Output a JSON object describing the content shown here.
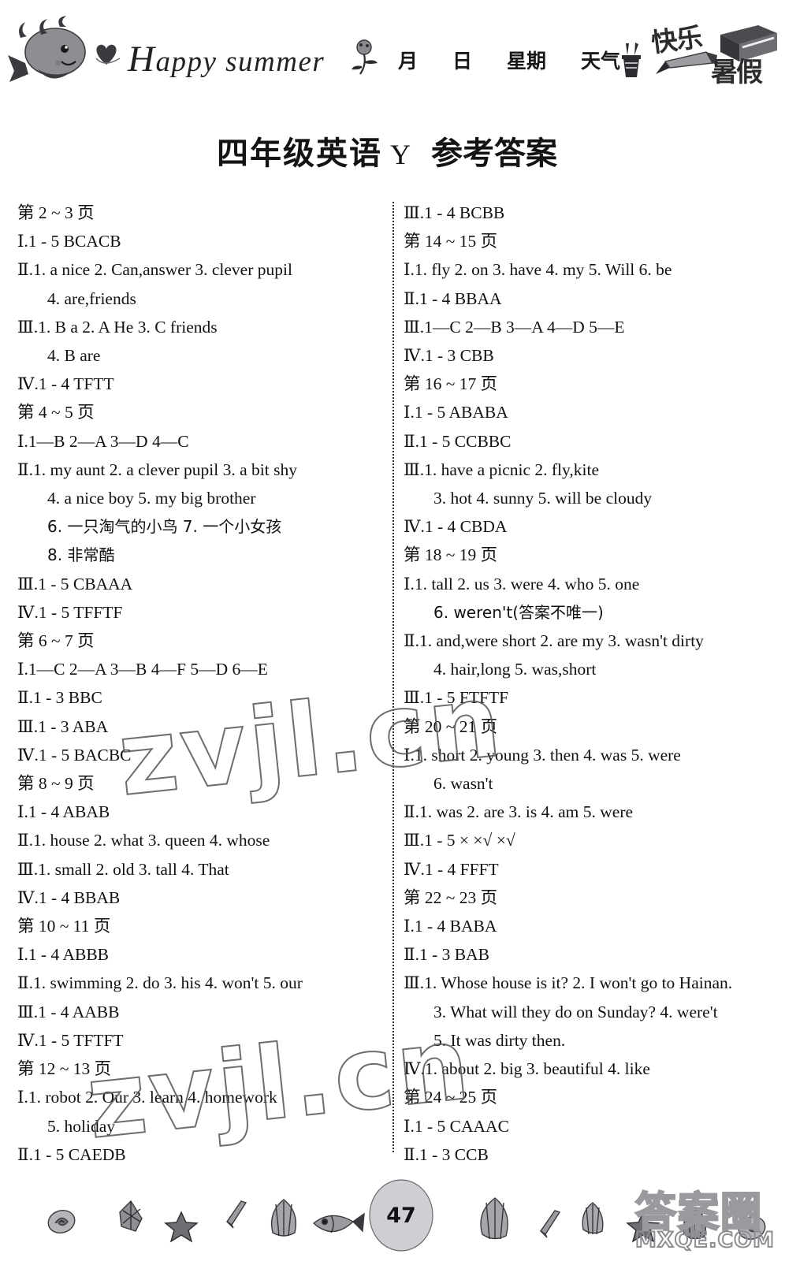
{
  "header": {
    "happy_summer_cap": "H",
    "happy_summer_rest": "appy summer",
    "date_fields": [
      "月",
      "日",
      "星期",
      "天气"
    ],
    "holiday_line1": "快乐",
    "holiday_line2": "暑假",
    "icons": {
      "whale": "whale-icon",
      "heart": "heart-icon",
      "flower": "flower-icon",
      "pencil_pot": "pencil-pot-icon",
      "book": "book-icon",
      "pencil": "pencil-icon"
    }
  },
  "title": {
    "subject": "四年级英语",
    "version": "Y",
    "label": "参考答案"
  },
  "left_column": [
    {
      "type": "page_head",
      "text": "第 2 ~ 3 页"
    },
    {
      "type": "answer",
      "text": "Ⅰ.1 - 5   BCACB"
    },
    {
      "type": "answer",
      "text": "Ⅱ.1. a nice   2. Can,answer   3. clever pupil"
    },
    {
      "type": "cont",
      "text": "4. are,friends"
    },
    {
      "type": "answer",
      "text": "Ⅲ.1. B   a   2. A   He   3. C   friends"
    },
    {
      "type": "cont",
      "text": "4. B   are"
    },
    {
      "type": "answer",
      "text": "Ⅳ.1 - 4   TFTT"
    },
    {
      "type": "page_head",
      "text": "第 4 ~ 5 页"
    },
    {
      "type": "answer",
      "text": "Ⅰ.1—B   2—A   3—D   4—C"
    },
    {
      "type": "answer",
      "text": "Ⅱ.1. my aunt   2. a clever pupil   3. a bit shy"
    },
    {
      "type": "cont",
      "text": "4. a nice boy   5. my big brother"
    },
    {
      "type": "cont_cn",
      "text": "6. 一只淘气的小鸟   7. 一个小女孩"
    },
    {
      "type": "cont_cn",
      "text": "8. 非常酷"
    },
    {
      "type": "answer",
      "text": "Ⅲ.1 - 5   CBAAA"
    },
    {
      "type": "answer",
      "text": "Ⅳ.1 - 5   TFFTF"
    },
    {
      "type": "page_head",
      "text": "第 6 ~ 7 页"
    },
    {
      "type": "answer",
      "text": "Ⅰ.1—C  2—A   3—B   4—F   5—D   6—E"
    },
    {
      "type": "answer",
      "text": "Ⅱ.1 - 3   BBC"
    },
    {
      "type": "answer",
      "text": "Ⅲ.1 - 3   ABA"
    },
    {
      "type": "answer",
      "text": "Ⅳ.1 - 5   BACBC"
    },
    {
      "type": "page_head",
      "text": "第 8 ~ 9 页"
    },
    {
      "type": "answer",
      "text": "Ⅰ.1 - 4   ABAB"
    },
    {
      "type": "answer",
      "text": "Ⅱ.1. house   2. what   3. queen   4. whose"
    },
    {
      "type": "answer",
      "text": "Ⅲ.1. small   2. old   3. tall   4. That"
    },
    {
      "type": "answer",
      "text": "Ⅳ.1 - 4   BBAB"
    },
    {
      "type": "page_head",
      "text": "第 10 ~ 11 页"
    },
    {
      "type": "answer",
      "text": "Ⅰ.1 - 4   ABBB"
    },
    {
      "type": "answer",
      "text": "Ⅱ.1. swimming   2. do   3. his   4. won't   5. our"
    },
    {
      "type": "answer",
      "text": "Ⅲ.1 - 4   AABB"
    },
    {
      "type": "answer",
      "text": "Ⅳ.1 - 5   TFTFT"
    },
    {
      "type": "page_head",
      "text": "第 12 ~ 13 页"
    },
    {
      "type": "answer",
      "text": "Ⅰ.1. robot   2. Our   3. learn   4. homework"
    },
    {
      "type": "cont",
      "text": "5. holiday"
    },
    {
      "type": "answer",
      "text": "Ⅱ.1 - 5   CAEDB"
    }
  ],
  "right_column": [
    {
      "type": "answer",
      "text": "Ⅲ.1 - 4   BCBB"
    },
    {
      "type": "page_head",
      "text": "第 14 ~ 15 页"
    },
    {
      "type": "answer",
      "text": "Ⅰ.1. fly   2. on   3. have   4. my   5. Will   6. be"
    },
    {
      "type": "answer",
      "text": "Ⅱ.1 - 4   BBAA"
    },
    {
      "type": "answer",
      "text": "Ⅲ.1—C   2—B   3—A   4—D   5—E"
    },
    {
      "type": "answer",
      "text": "Ⅳ.1 - 3   CBB"
    },
    {
      "type": "page_head",
      "text": "第 16 ~ 17 页"
    },
    {
      "type": "answer",
      "text": "Ⅰ.1 - 5   ABABA"
    },
    {
      "type": "answer",
      "text": "Ⅱ.1 - 5   CCBBC"
    },
    {
      "type": "answer",
      "text": "Ⅲ.1. have a picnic   2. fly,kite"
    },
    {
      "type": "cont",
      "text": "3. hot   4. sunny   5. will be cloudy"
    },
    {
      "type": "answer",
      "text": "Ⅳ.1 - 4   CBDA"
    },
    {
      "type": "page_head",
      "text": "第 18 ~ 19 页"
    },
    {
      "type": "answer",
      "text": "Ⅰ.1. tall   2. us   3. were   4. who   5. one"
    },
    {
      "type": "cont_cn",
      "text": "6. weren't(答案不唯一)"
    },
    {
      "type": "answer",
      "text": "Ⅱ.1. and,were short   2. are my   3. wasn't dirty"
    },
    {
      "type": "cont",
      "text": "4. hair,long   5. was,short"
    },
    {
      "type": "answer",
      "text": "Ⅲ.1 - 5   FTFTF"
    },
    {
      "type": "page_head",
      "text": "第 20 ~ 21 页"
    },
    {
      "type": "answer",
      "text": "Ⅰ.1. short   2. young   3. then   4. was   5. were"
    },
    {
      "type": "cont",
      "text": "6. wasn't"
    },
    {
      "type": "answer",
      "text": "Ⅱ.1. was   2. are   3. is   4. am   5. were"
    },
    {
      "type": "answer",
      "text": "Ⅲ.1 - 5   × ×√ ×√"
    },
    {
      "type": "answer",
      "text": "Ⅳ.1 - 4   FFFT"
    },
    {
      "type": "page_head",
      "text": "第 22 ~ 23 页"
    },
    {
      "type": "answer",
      "text": "Ⅰ.1 - 4   BABA"
    },
    {
      "type": "answer",
      "text": "Ⅱ.1 - 3   BAB"
    },
    {
      "type": "answer",
      "text": "Ⅲ.1. Whose house is it?   2. I won't go to Hainan."
    },
    {
      "type": "cont",
      "text": "3. What will they do on Sunday?    4. were't"
    },
    {
      "type": "cont",
      "text": "5. It was dirty then."
    },
    {
      "type": "answer",
      "text": "Ⅳ.1. about   2. big   3. beautiful   4. like"
    },
    {
      "type": "page_head",
      "text": "第 24 ~ 25 页"
    },
    {
      "type": "answer",
      "text": "Ⅰ.1 - 5   CAAAC"
    },
    {
      "type": "answer",
      "text": "Ⅱ.1 - 3   CCB"
    }
  ],
  "watermarks": {
    "body_text": "zvjl.cn",
    "footer_logo": "答案圈",
    "footer_domain": "MXQE.COM"
  },
  "footer": {
    "page_number": "47"
  }
}
